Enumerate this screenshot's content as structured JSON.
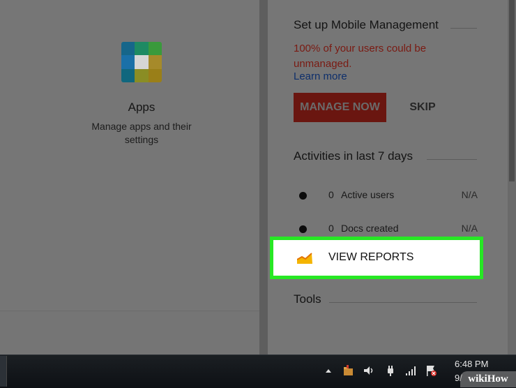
{
  "apps": {
    "title": "Apps",
    "description": "Manage apps and their settings",
    "icon": "apps-grid-icon",
    "icon_colors": [
      "#16668a",
      "#1e8a63",
      "#3a9a3c",
      "#1a70a8",
      "#d6d6d6",
      "#a68a2a",
      "#10677e",
      "#8a8d24",
      "#9a7f18"
    ]
  },
  "mobile": {
    "title": "Set up Mobile Management",
    "warning": "100% of your users could be unmanaged.",
    "learn_more": "Learn more",
    "manage_button": "MANAGE NOW",
    "skip_button": "SKIP"
  },
  "activities": {
    "title": "Activities in last 7 days",
    "rows": [
      {
        "count": "0",
        "label": "Active users",
        "value": "N/A"
      },
      {
        "count": "0",
        "label": "Docs created",
        "value": "N/A"
      }
    ],
    "view_reports": "VIEW REPORTS"
  },
  "tools": {
    "title": "Tools"
  },
  "taskbar": {
    "time": "6:48 PM",
    "date": "9/",
    "tray_icons": [
      "network-folder-icon",
      "volume-icon",
      "power-plug-icon",
      "signal-bars-icon",
      "flag-alert-icon"
    ]
  },
  "watermark": "wikiHow",
  "colors": {
    "highlight": "#27e824",
    "manage_button": "#6a1610",
    "warning_text": "#7a1a12",
    "link": "#0e2f6b"
  }
}
